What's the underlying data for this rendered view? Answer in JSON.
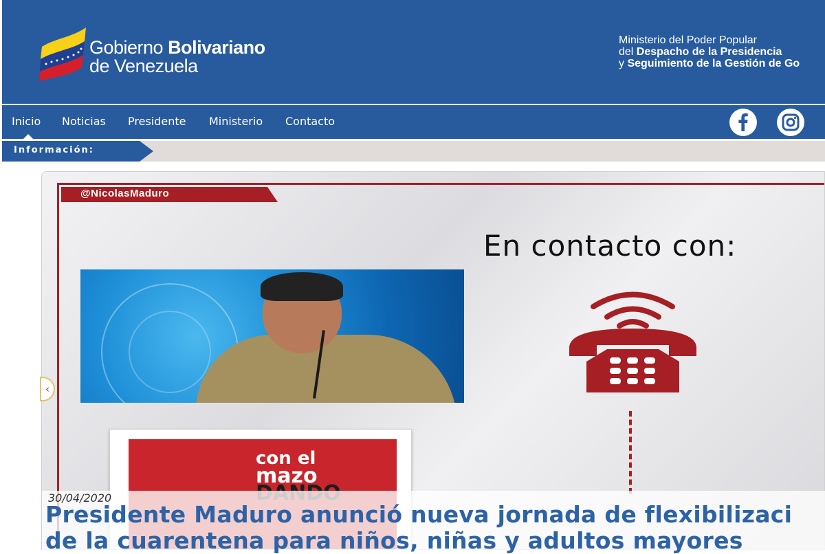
{
  "header": {
    "logo_line1_regular": "Gobierno ",
    "logo_line1_bold": "Bolivariano",
    "logo_line2": "de Venezuela",
    "ministry_line1": "Ministerio del Poder Popular",
    "ministry_line2_prefix": "del ",
    "ministry_line2_bold": "Despacho de la Presidencia",
    "ministry_line3_prefix": "y ",
    "ministry_line3_bold": "Seguimiento de la Gestión de Go"
  },
  "nav": {
    "items": [
      {
        "label": "Inicio",
        "active": true
      },
      {
        "label": "Noticias"
      },
      {
        "label": "Presidente"
      },
      {
        "label": "Ministerio"
      },
      {
        "label": "Contacto"
      }
    ],
    "social": [
      {
        "icon": "facebook-icon"
      },
      {
        "icon": "instagram-icon"
      }
    ]
  },
  "info_bar": {
    "label": "Información:"
  },
  "slide": {
    "handle": "@NicolasMaduro",
    "contact_title": "En contacto con:",
    "promo_line1": "con el",
    "promo_line2": "mazo",
    "promo_line3": "DANDO",
    "prev_icon": "chevron-left-icon",
    "date": "30/04/2020",
    "title_line1": "Presidente Maduro anunció nueva jornada de flexibilizaci",
    "title_line2": "de la cuarentena para niños, niñas y adultos mayores"
  },
  "colors": {
    "header_blue": "#285b9d",
    "accent_red": "#a51f24",
    "info_bar_bg": "#e1dbda",
    "title_blue": "#2d63a6"
  }
}
